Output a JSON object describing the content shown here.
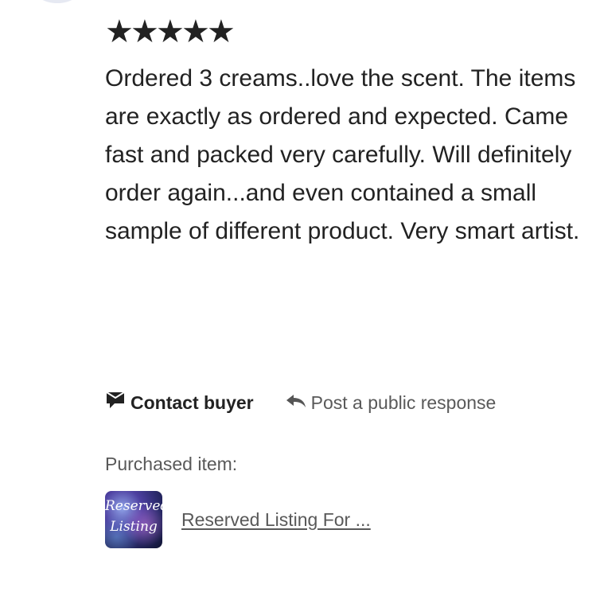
{
  "review": {
    "rating_value": 5,
    "stars": [
      "★",
      "★",
      "★",
      "★",
      "★"
    ],
    "text": "Ordered 3 creams..love the scent. The items are exactly as ordered and expected. Came fast and packed very carefully. Will definitely order again...and even contained a small sample of different product. Very smart artist."
  },
  "actions": {
    "contact_buyer_label": "Contact buyer",
    "contact_icon": "message-icon",
    "public_response_label": "Post a public response",
    "public_response_icon": "reply-arrow-icon"
  },
  "purchase": {
    "label": "Purchased item:",
    "thumb_line1": "Reserved",
    "thumb_line2": "Listing",
    "item_title": "Reserved Listing For ..."
  },
  "colors": {
    "text_primary": "#222222",
    "text_secondary": "#595959"
  }
}
